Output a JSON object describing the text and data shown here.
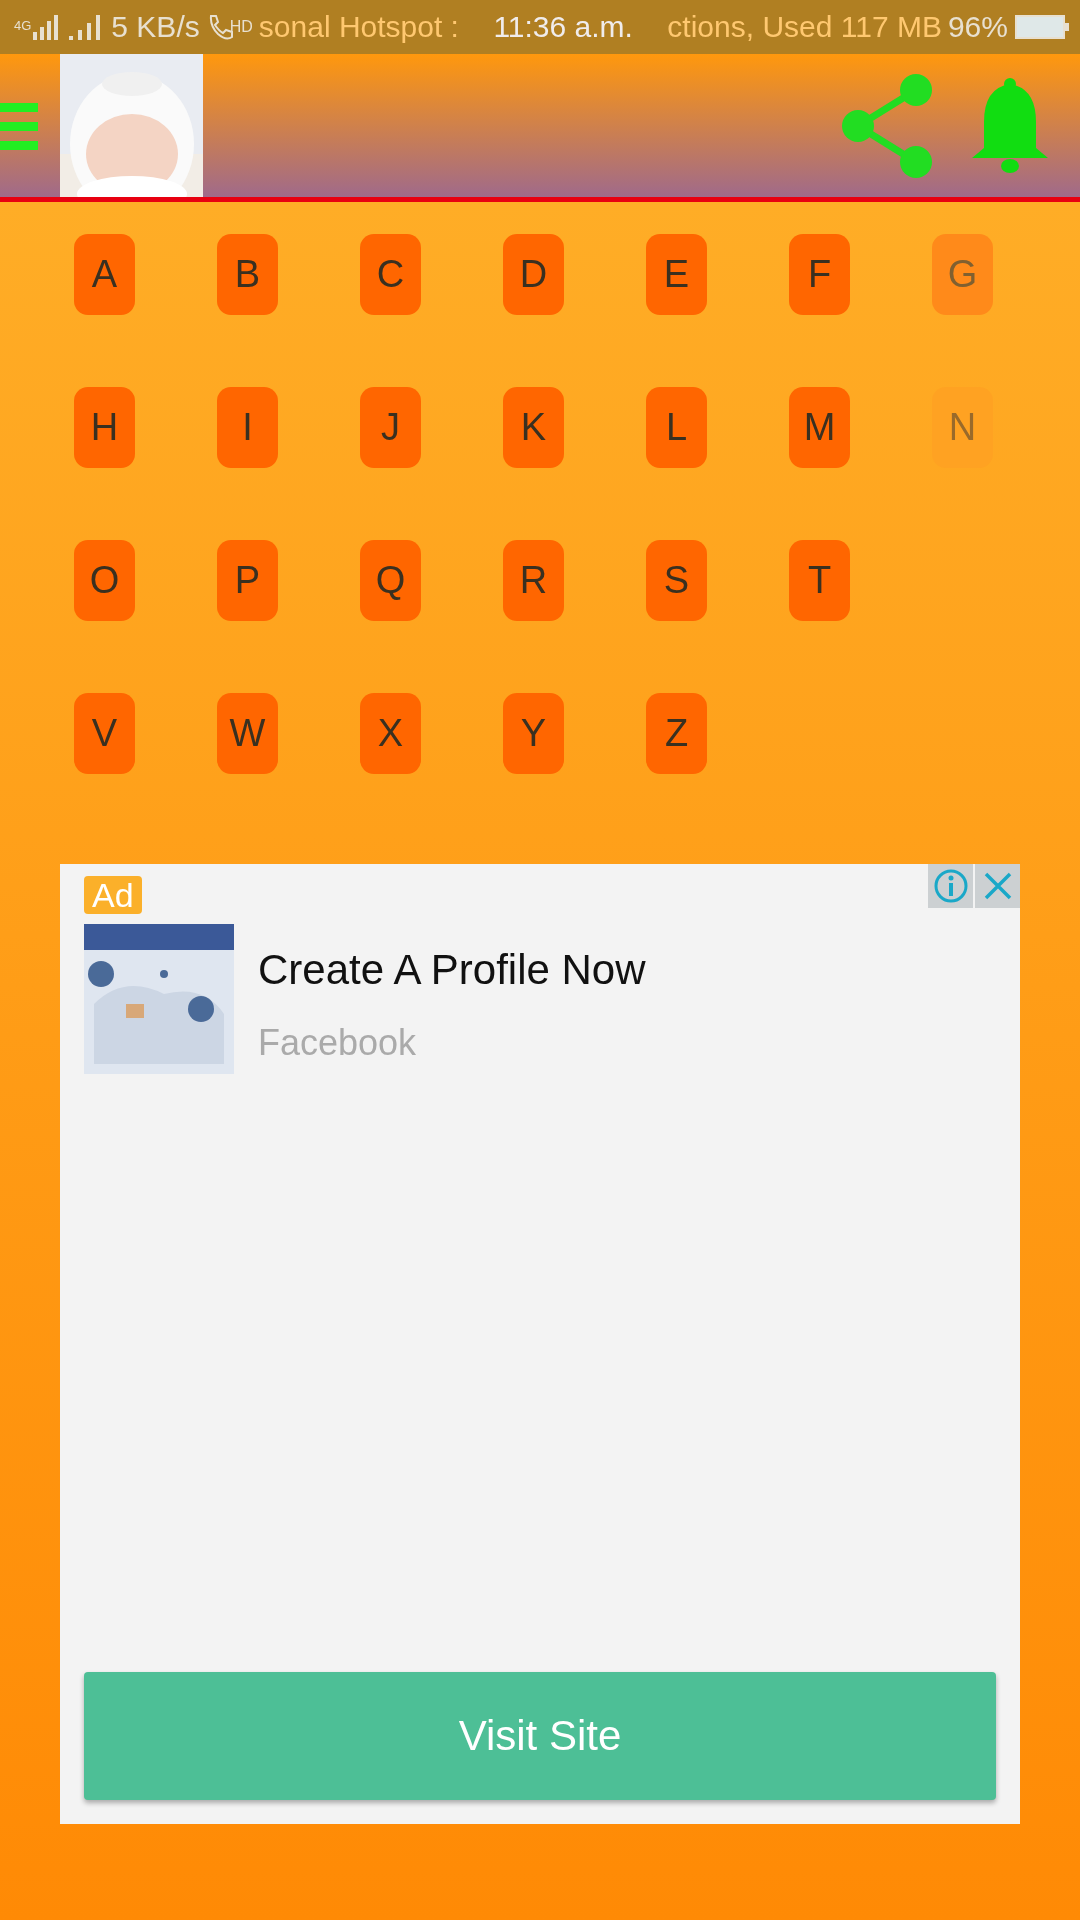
{
  "status_bar": {
    "network": "4G",
    "speed": "5 KB/s",
    "call": "HD",
    "ticker_left": "sonal Hotspot :",
    "ticker_right": "ctions, Used 117 MB",
    "time": "11:36 a.m.",
    "battery": "96%"
  },
  "letters": [
    {
      "label": "A",
      "kind": "solid"
    },
    {
      "label": "B",
      "kind": "solid"
    },
    {
      "label": "C",
      "kind": "solid"
    },
    {
      "label": "D",
      "kind": "solid"
    },
    {
      "label": "E",
      "kind": "solid"
    },
    {
      "label": "F",
      "kind": "solid"
    },
    {
      "label": "G",
      "kind": "fading"
    },
    {
      "label": "H",
      "kind": "solid"
    },
    {
      "label": "I",
      "kind": "solid"
    },
    {
      "label": "J",
      "kind": "solid"
    },
    {
      "label": "K",
      "kind": "solid"
    },
    {
      "label": "L",
      "kind": "solid"
    },
    {
      "label": "M",
      "kind": "solid"
    },
    {
      "label": "N",
      "kind": "faint"
    },
    {
      "label": "O",
      "kind": "solid"
    },
    {
      "label": "P",
      "kind": "solid"
    },
    {
      "label": "Q",
      "kind": "solid"
    },
    {
      "label": "R",
      "kind": "solid"
    },
    {
      "label": "S",
      "kind": "solid"
    },
    {
      "label": "T",
      "kind": "solid"
    },
    {
      "kind": "empty"
    },
    {
      "label": "V",
      "kind": "solid"
    },
    {
      "label": "W",
      "kind": "solid"
    },
    {
      "label": "X",
      "kind": "solid"
    },
    {
      "label": "Y",
      "kind": "solid"
    },
    {
      "label": "Z",
      "kind": "solid"
    }
  ],
  "ad": {
    "badge": "Ad",
    "title": "Create A Profile Now",
    "advertiser": "Facebook",
    "button": "Visit Site"
  }
}
